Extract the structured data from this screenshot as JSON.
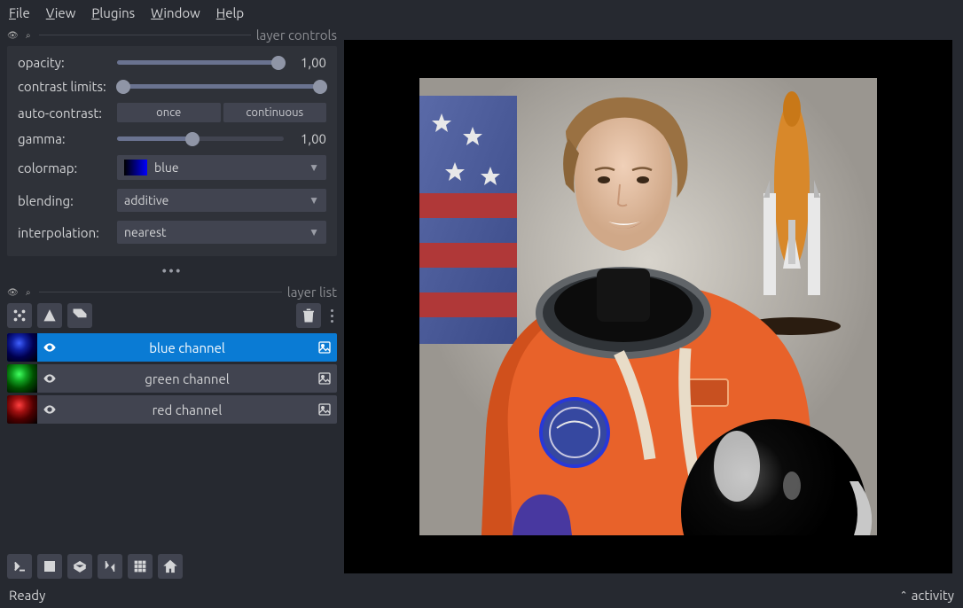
{
  "menu": {
    "file": "File",
    "view": "View",
    "plugins": "Plugins",
    "window": "Window",
    "help": "Help"
  },
  "panels": {
    "controls_title": "layer controls",
    "list_title": "layer list"
  },
  "controls": {
    "opacity_label": "opacity:",
    "opacity_value": "1,00",
    "contrast_label": "contrast limits:",
    "autocontrast_label": "auto-contrast:",
    "once": "once",
    "continuous": "continuous",
    "gamma_label": "gamma:",
    "gamma_value": "1,00",
    "colormap_label": "colormap:",
    "colormap_value": "blue",
    "blending_label": "blending:",
    "blending_value": "additive",
    "interpolation_label": "interpolation:",
    "interpolation_value": "nearest"
  },
  "layers": [
    {
      "name": "blue channel",
      "selected": true,
      "color": "blue"
    },
    {
      "name": "green channel",
      "selected": false,
      "color": "green"
    },
    {
      "name": "red channel",
      "selected": false,
      "color": "red"
    }
  ],
  "status": {
    "ready": "Ready",
    "activity": "activity"
  }
}
